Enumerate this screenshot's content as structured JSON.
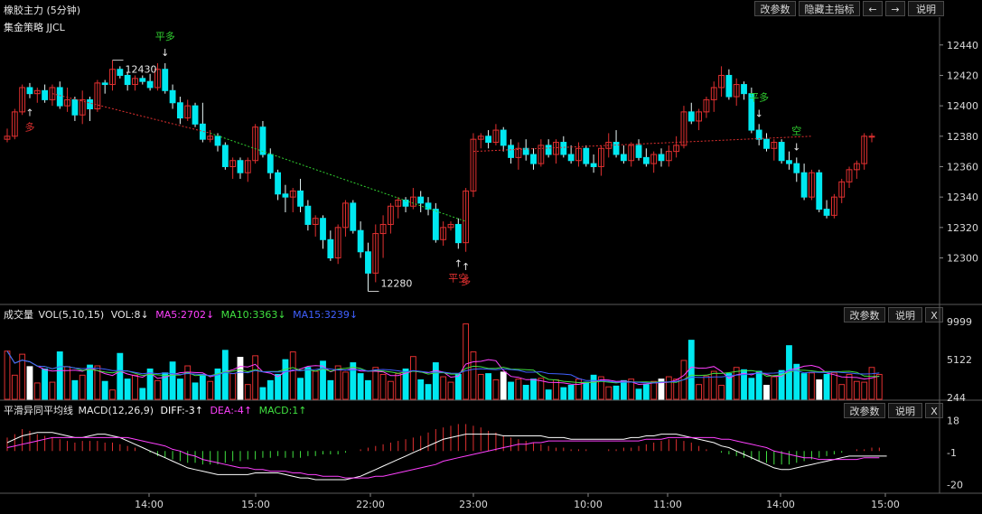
{
  "header": {
    "title": "橡胶主力 (5分钟)",
    "buttons": [
      "改参数",
      "隐藏主指标",
      "←",
      "→",
      "说明"
    ]
  },
  "main_panel": {
    "strategy_label": "集金策略 JJCL",
    "y_ticks": [
      "12440",
      "12420",
      "12400",
      "12380",
      "12360",
      "12340",
      "12320",
      "12300"
    ],
    "high_label": "12430",
    "low_label": "12280",
    "signals": [
      {
        "text": "多",
        "color": "#e03030"
      },
      {
        "text": "平多",
        "color": "#30d030"
      },
      {
        "text": "多",
        "color": "#e03030"
      },
      {
        "text": "平空",
        "color": "#e03030"
      },
      {
        "text": "平多",
        "color": "#30d030"
      },
      {
        "text": "空",
        "color": "#30d030"
      }
    ]
  },
  "volume_panel": {
    "name": "成交量",
    "params": "VOL(5,10,15)",
    "vol_label": "VOL:8↓",
    "ma5_label": "MA5:2702↓",
    "ma10_label": "MA10:3363↓",
    "ma15_label": "MA15:3239↓",
    "y_ticks": [
      "9999",
      "5122",
      "244"
    ],
    "buttons": [
      "改参数",
      "说明",
      "X"
    ]
  },
  "macd_panel": {
    "name": "平滑异同平均线",
    "params": "MACD(12,26,9)",
    "diff_label": "DIFF:-3↑",
    "dea_label": "DEA:-4↑",
    "macd_label": "MACD:1↑",
    "y_ticks": [
      "18",
      "-1",
      "-20"
    ],
    "buttons": [
      "改参数",
      "说明",
      "X"
    ]
  },
  "time_axis": [
    "14:00",
    "15:00",
    "22:00",
    "23:00",
    "10:00",
    "11:00",
    "14:00",
    "15:00"
  ],
  "colors": {
    "up": "#e03030",
    "down": "#00e8f0",
    "ma5": "#ff40ff",
    "ma10": "#40e040",
    "ma15": "#4060ff",
    "diff": "#ffffff",
    "dea": "#ff40ff"
  },
  "chart_data": {
    "type": "candlestick",
    "ylim": [
      12270,
      12447
    ],
    "candles": [
      [
        12378,
        12385,
        12376,
        12380
      ],
      [
        12380,
        12398,
        12378,
        12396
      ],
      [
        12396,
        12414,
        12394,
        12412
      ],
      [
        12412,
        12415,
        12405,
        12408
      ],
      [
        12408,
        12412,
        12402,
        12410
      ],
      [
        12410,
        12414,
        12402,
        12404
      ],
      [
        12404,
        12414,
        12400,
        12412
      ],
      [
        12412,
        12416,
        12398,
        12400
      ],
      [
        12400,
        12412,
        12396,
        12404
      ],
      [
        12404,
        12406,
        12390,
        12394
      ],
      [
        12394,
        12410,
        12388,
        12404
      ],
      [
        12404,
        12406,
        12390,
        12398
      ],
      [
        12398,
        12417,
        12396,
        12415
      ],
      [
        12415,
        12417,
        12408,
        12414
      ],
      [
        12414,
        12430,
        12410,
        12424
      ],
      [
        12424,
        12426,
        12418,
        12420
      ],
      [
        12420,
        12422,
        12410,
        12414
      ],
      [
        12414,
        12420,
        12410,
        12418
      ],
      [
        12418,
        12420,
        12414,
        12416
      ],
      [
        12416,
        12421,
        12410,
        12412
      ],
      [
        12412,
        12428,
        12410,
        12424
      ],
      [
        12424,
        12428,
        12408,
        12410
      ],
      [
        12410,
        12414,
        12398,
        12402
      ],
      [
        12402,
        12406,
        12388,
        12392
      ],
      [
        12392,
        12404,
        12390,
        12400
      ],
      [
        12400,
        12402,
        12386,
        12388
      ],
      [
        12388,
        12402,
        12376,
        12378
      ],
      [
        12378,
        12384,
        12376,
        12380
      ],
      [
        12380,
        12382,
        12370,
        12374
      ],
      [
        12374,
        12376,
        12358,
        12360
      ],
      [
        12360,
        12366,
        12352,
        12364
      ],
      [
        12364,
        12366,
        12352,
        12356
      ],
      [
        12356,
        12366,
        12350,
        12364
      ],
      [
        12364,
        12388,
        12362,
        12386
      ],
      [
        12386,
        12390,
        12366,
        12368
      ],
      [
        12368,
        12372,
        12352,
        12356
      ],
      [
        12356,
        12358,
        12338,
        12342
      ],
      [
        12342,
        12348,
        12330,
        12340
      ],
      [
        12340,
        12346,
        12330,
        12344
      ],
      [
        12344,
        12352,
        12330,
        12334
      ],
      [
        12334,
        12338,
        12318,
        12322
      ],
      [
        12322,
        12328,
        12314,
        12326
      ],
      [
        12326,
        12328,
        12306,
        12312
      ],
      [
        12312,
        12318,
        12298,
        12300
      ],
      [
        12300,
        12322,
        12296,
        12320
      ],
      [
        12320,
        12338,
        12314,
        12336
      ],
      [
        12336,
        12338,
        12316,
        12318
      ],
      [
        12318,
        12324,
        12300,
        12304
      ],
      [
        12304,
        12310,
        12278,
        12290
      ],
      [
        12290,
        12322,
        12284,
        12316
      ],
      [
        12316,
        12328,
        12300,
        12322
      ],
      [
        12322,
        12336,
        12316,
        12334
      ],
      [
        12334,
        12340,
        12326,
        12338
      ],
      [
        12338,
        12340,
        12330,
        12334
      ],
      [
        12334,
        12346,
        12332,
        12340
      ],
      [
        12340,
        12344,
        12330,
        12336
      ],
      [
        12336,
        12340,
        12328,
        12332
      ],
      [
        12332,
        12336,
        12310,
        12312
      ],
      [
        12312,
        12324,
        12308,
        12320
      ],
      [
        12320,
        12324,
        12318,
        12322
      ],
      [
        12322,
        12326,
        12306,
        12310
      ],
      [
        12310,
        12346,
        12304,
        12344
      ],
      [
        12344,
        12382,
        12340,
        12378
      ],
      [
        12378,
        12382,
        12372,
        12380
      ],
      [
        12380,
        12384,
        12372,
        12376
      ],
      [
        12376,
        12388,
        12374,
        12384
      ],
      [
        12384,
        12386,
        12370,
        12374
      ],
      [
        12374,
        12378,
        12362,
        12366
      ],
      [
        12366,
        12376,
        12358,
        12372
      ],
      [
        12372,
        12378,
        12364,
        12368
      ],
      [
        12368,
        12372,
        12358,
        12362
      ],
      [
        12362,
        12378,
        12360,
        12374
      ],
      [
        12374,
        12378,
        12366,
        12368
      ],
      [
        12368,
        12378,
        12362,
        12376
      ],
      [
        12376,
        12380,
        12366,
        12368
      ],
      [
        12368,
        12374,
        12362,
        12364
      ],
      [
        12364,
        12376,
        12360,
        12372
      ],
      [
        12372,
        12374,
        12360,
        12362
      ],
      [
        12362,
        12368,
        12356,
        12360
      ],
      [
        12360,
        12374,
        12354,
        12372
      ],
      [
        12372,
        12382,
        12366,
        12376
      ],
      [
        12376,
        12384,
        12366,
        12368
      ],
      [
        12368,
        12374,
        12362,
        12364
      ],
      [
        12364,
        12376,
        12360,
        12374
      ],
      [
        12374,
        12378,
        12364,
        12366
      ],
      [
        12366,
        12372,
        12360,
        12362
      ],
      [
        12362,
        12370,
        12356,
        12368
      ],
      [
        12368,
        12372,
        12360,
        12364
      ],
      [
        12364,
        12374,
        12360,
        12370
      ],
      [
        12370,
        12380,
        12366,
        12374
      ],
      [
        12374,
        12400,
        12372,
        12396
      ],
      [
        12396,
        12402,
        12388,
        12390
      ],
      [
        12390,
        12398,
        12384,
        12396
      ],
      [
        12396,
        12406,
        12392,
        12404
      ],
      [
        12404,
        12416,
        12396,
        12412
      ],
      [
        12412,
        12426,
        12406,
        12420
      ],
      [
        12420,
        12424,
        12404,
        12406
      ],
      [
        12406,
        12418,
        12400,
        12414
      ],
      [
        12414,
        12416,
        12404,
        12408
      ],
      [
        12408,
        12412,
        12382,
        12384
      ],
      [
        12384,
        12388,
        12374,
        12378
      ],
      [
        12378,
        12382,
        12370,
        12372
      ],
      [
        12372,
        12378,
        12364,
        12376
      ],
      [
        12376,
        12378,
        12362,
        12364
      ],
      [
        12364,
        12370,
        12358,
        12362
      ],
      [
        12362,
        12366,
        12350,
        12356
      ],
      [
        12356,
        12362,
        12338,
        12340
      ],
      [
        12340,
        12358,
        12338,
        12356
      ],
      [
        12356,
        12358,
        12330,
        12332
      ],
      [
        12332,
        12338,
        12326,
        12328
      ],
      [
        12328,
        12342,
        12326,
        12340
      ],
      [
        12340,
        12352,
        12336,
        12350
      ],
      [
        12350,
        12360,
        12346,
        12358
      ],
      [
        12358,
        12364,
        12352,
        12362
      ],
      [
        12362,
        12382,
        12358,
        12380
      ],
      [
        12380,
        12382,
        12376,
        12380
      ]
    ],
    "trend_lines": [
      {
        "from": [
          6,
          12408
        ],
        "to": [
          27,
          12382
        ],
        "color": "#e03030"
      },
      {
        "from": [
          27,
          12382
        ],
        "to": [
          61,
          12324
        ],
        "color": "#30d030"
      },
      {
        "from": [
          62,
          12370
        ],
        "to": [
          107,
          12380
        ],
        "color": "#e03030"
      }
    ],
    "volume": {
      "ylim": [
        0,
        9999
      ],
      "values": [
        6200,
        3100,
        5800,
        4200,
        2100,
        3900,
        2200,
        6100,
        4200,
        2400,
        3100,
        4400,
        4300,
        2300,
        1200,
        5900,
        2600,
        3100,
        1400,
        3900,
        2400,
        3400,
        4800,
        2600,
        4300,
        2100,
        3200,
        2300,
        3900,
        6300,
        3300,
        5400,
        1900,
        5600,
        1500,
        2400,
        3200,
        5100,
        6100,
        2700,
        4100,
        3600,
        4900,
        2400,
        4300,
        3500,
        4700,
        3300,
        2400,
        4100,
        3200,
        2300,
        3300,
        3900,
        5500,
        2500,
        1900,
        4700,
        2900,
        2200,
        3200,
        9700,
        6100,
        3200,
        3300,
        2500,
        3500,
        2200,
        2600,
        1800,
        2600,
        2700,
        1200,
        2500,
        1500,
        1800,
        2600,
        2200,
        3100,
        2900,
        1600,
        1700,
        2400,
        2600,
        1300,
        1900,
        2300,
        2600,
        2900,
        2600,
        5000,
        7600,
        1900,
        3000,
        3600,
        1800,
        3300,
        4100,
        3800,
        2700,
        3600,
        1800,
        2900,
        3700,
        6900,
        4500,
        3300,
        3400,
        2500,
        3200,
        3400,
        1900,
        3200,
        2300,
        2200,
        4100,
        3200
      ]
    },
    "macd": {
      "ylim": [
        -24,
        20
      ],
      "hist": [
        8,
        10,
        13,
        12,
        10,
        9,
        8,
        7,
        6,
        5,
        6,
        6,
        6,
        5,
        5,
        4,
        3,
        2,
        0,
        -1,
        -3,
        -4,
        -5,
        -6,
        -7,
        -7,
        -8,
        -8,
        -8,
        -7,
        -6,
        -6,
        -5,
        -5,
        -4,
        -4,
        -3,
        -4,
        -4,
        -4,
        -3,
        -3,
        -2,
        -2,
        -2,
        -1,
        0,
        1,
        2,
        3,
        4,
        5,
        6,
        7,
        8,
        9,
        11,
        13,
        14,
        15,
        16,
        16,
        15,
        14,
        12,
        11,
        9,
        8,
        7,
        6,
        5,
        4,
        3,
        2,
        2,
        1,
        1,
        1,
        0,
        0,
        1,
        1,
        2,
        2,
        3,
        4,
        5,
        6,
        7,
        7,
        6,
        5,
        3,
        1,
        0,
        -1,
        -2,
        -3,
        -4,
        -5,
        -6,
        -7,
        -8,
        -8,
        -8,
        -7,
        -6,
        -5,
        -4,
        -3,
        -2,
        -1,
        0,
        1,
        1,
        2,
        2
      ],
      "diff": [
        5,
        7,
        9,
        10,
        11,
        11,
        11,
        10,
        9,
        8,
        8,
        9,
        10,
        10,
        9,
        8,
        6,
        4,
        2,
        0,
        -2,
        -4,
        -6,
        -8,
        -10,
        -11,
        -12,
        -13,
        -14,
        -14,
        -14,
        -14,
        -14,
        -13,
        -13,
        -13,
        -13,
        -14,
        -15,
        -16,
        -16,
        -17,
        -17,
        -17,
        -17,
        -17,
        -16,
        -15,
        -13,
        -11,
        -9,
        -7,
        -5,
        -3,
        -1,
        1,
        3,
        5,
        7,
        8,
        9,
        10,
        10,
        10,
        10,
        10,
        9,
        9,
        9,
        9,
        9,
        9,
        8,
        8,
        8,
        7,
        7,
        7,
        7,
        7,
        7,
        7,
        7,
        8,
        8,
        9,
        9,
        10,
        10,
        10,
        9,
        8,
        7,
        6,
        5,
        3,
        2,
        0,
        -2,
        -4,
        -6,
        -8,
        -10,
        -11,
        -11,
        -10,
        -9,
        -8,
        -7,
        -6,
        -5,
        -4,
        -3,
        -3,
        -3,
        -3,
        -3,
        -3
      ],
      "dea": [
        2,
        3,
        4,
        5,
        6,
        7,
        8,
        8,
        8,
        8,
        8,
        8,
        8,
        8,
        8,
        8,
        8,
        7,
        6,
        5,
        4,
        3,
        1,
        0,
        -2,
        -3,
        -5,
        -6,
        -7,
        -8,
        -9,
        -10,
        -10,
        -11,
        -11,
        -12,
        -12,
        -12,
        -13,
        -13,
        -14,
        -14,
        -15,
        -15,
        -15,
        -16,
        -16,
        -16,
        -16,
        -15,
        -15,
        -14,
        -13,
        -12,
        -11,
        -10,
        -9,
        -8,
        -6,
        -5,
        -4,
        -3,
        -2,
        -1,
        0,
        1,
        2,
        3,
        4,
        4,
        5,
        5,
        6,
        6,
        6,
        6,
        6,
        6,
        6,
        6,
        6,
        6,
        6,
        6,
        6,
        7,
        7,
        7,
        8,
        8,
        8,
        8,
        8,
        8,
        8,
        7,
        7,
        6,
        5,
        4,
        3,
        2,
        0,
        -1,
        -2,
        -3,
        -4,
        -4,
        -5,
        -5,
        -5,
        -5,
        -5,
        -5,
        -4,
        -4,
        -4
      ]
    }
  }
}
